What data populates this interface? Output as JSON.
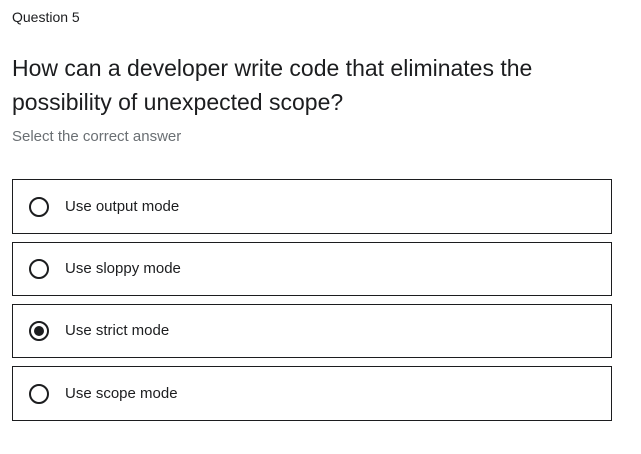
{
  "question": {
    "label": "Question 5",
    "text": "How can a developer write code that eliminates the possibility of unexpected scope?",
    "instruction": "Select the correct answer"
  },
  "options": [
    {
      "label": "Use output mode",
      "selected": false
    },
    {
      "label": "Use sloppy mode",
      "selected": false
    },
    {
      "label": "Use strict mode",
      "selected": true
    },
    {
      "label": "Use scope mode",
      "selected": false
    }
  ],
  "colors": {
    "text": "#1c1d1f",
    "muted": "#6a6f73",
    "border": "#1c1d1f"
  }
}
